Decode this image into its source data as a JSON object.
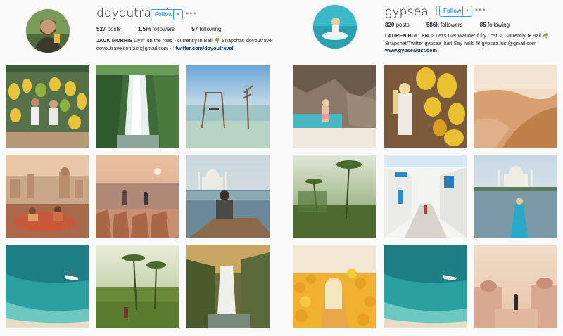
{
  "profiles": [
    {
      "username": "doyoutravel",
      "follow_label": "Follow",
      "dropdown_icon": "caret-down-icon",
      "more_icon": "ellipsis-icon",
      "more_glyph": "•••",
      "caret_glyph": "▾",
      "stats": {
        "posts_count": "527",
        "posts_label": "posts",
        "followers_count": "1.5m",
        "followers_label": "followers",
        "following_count": "97",
        "following_label": "following"
      },
      "bio": {
        "name": "JACK MORRIS",
        "line1": " Livin' on the road - currently in Bali 🌴 Snapchat: doyoutravel",
        "email": "doyoutravelcontact@gmail.com",
        "separator": " ♡ ",
        "link": "twitter.com/doyoutravel"
      },
      "posts": [
        "fruit-market-couple",
        "jungle-waterfall",
        "ocean-swing",
        "city-rooftop-picnic",
        "sunset-fort-view",
        "boat-taj-mahal",
        "turquoise-beach-boat",
        "rice-terrace-palms",
        "forest-waterfall"
      ]
    },
    {
      "username": "gypsea_lust",
      "follow_label": "Follow",
      "dropdown_icon": "caret-down-icon",
      "more_icon": "ellipsis-icon",
      "more_glyph": "•••",
      "caret_glyph": "▾",
      "stats": {
        "posts_count": "820",
        "posts_label": "posts",
        "followers_count": "586k",
        "followers_label": "followers",
        "following_count": "85",
        "following_label": "following"
      },
      "bio": {
        "name": "LAUREN BULLEN",
        "line1": " ✧ Let's Get Wander-fully Lost ✧ Currently ➤ Bali 🌴",
        "line2": "Snapchat/Twitter gypsea_lust Say hello ✉ gypsea.lust@gmail.com",
        "link": "www.gypsealust.com"
      },
      "posts": [
        "rocky-beach-girl",
        "banana-market-girl",
        "desert-dunes",
        "jungle-palm-sunrise",
        "white-alley-steps",
        "taj-mahal-reflection",
        "yellow-flowers-girl",
        "turquoise-beach-boat",
        "temple-sunset-terrace"
      ]
    }
  ]
}
